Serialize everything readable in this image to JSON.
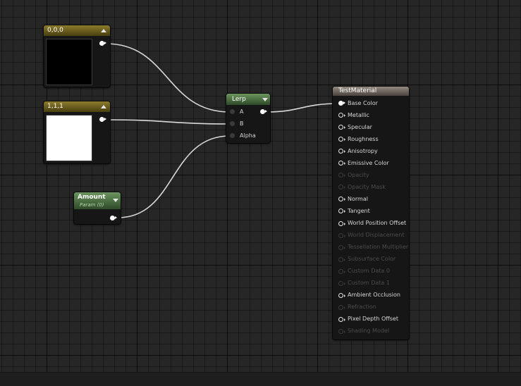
{
  "nodes": {
    "const_black": {
      "title": "0,0,0",
      "swatch_color": "#000000"
    },
    "const_white": {
      "title": "1,1,1",
      "swatch_color": "#ffffff"
    },
    "amount": {
      "title": "Amount",
      "subtitle": "Param (0)"
    },
    "lerp": {
      "title": "Lerp",
      "inputs": [
        "A",
        "B",
        "Alpha"
      ]
    },
    "material": {
      "title": "TestMaterial",
      "pins": [
        {
          "label": "Base Color",
          "state": "connected"
        },
        {
          "label": "Metallic",
          "state": "enabled"
        },
        {
          "label": "Specular",
          "state": "enabled"
        },
        {
          "label": "Roughness",
          "state": "enabled"
        },
        {
          "label": "Anisotropy",
          "state": "enabled"
        },
        {
          "label": "Emissive Color",
          "state": "enabled"
        },
        {
          "label": "Opacity",
          "state": "disabled"
        },
        {
          "label": "Opacity Mask",
          "state": "disabled"
        },
        {
          "label": "Normal",
          "state": "enabled"
        },
        {
          "label": "Tangent",
          "state": "enabled"
        },
        {
          "label": "World Position Offset",
          "state": "enabled"
        },
        {
          "label": "World Displacement",
          "state": "disabled"
        },
        {
          "label": "Tessellation Multiplier",
          "state": "disabled"
        },
        {
          "label": "Subsurface Color",
          "state": "disabled"
        },
        {
          "label": "Custom Data 0",
          "state": "disabled"
        },
        {
          "label": "Custom Data 1",
          "state": "disabled"
        },
        {
          "label": "Ambient Occlusion",
          "state": "enabled"
        },
        {
          "label": "Refraction",
          "state": "disabled"
        },
        {
          "label": "Pixel Depth Offset",
          "state": "enabled"
        },
        {
          "label": "Shading Model",
          "state": "disabled"
        }
      ]
    }
  },
  "colors": {
    "wire": "#d9d9d9",
    "yellow_header": "#8c7c2c",
    "green_header": "#6b955e",
    "grey_header": "#938a80"
  }
}
